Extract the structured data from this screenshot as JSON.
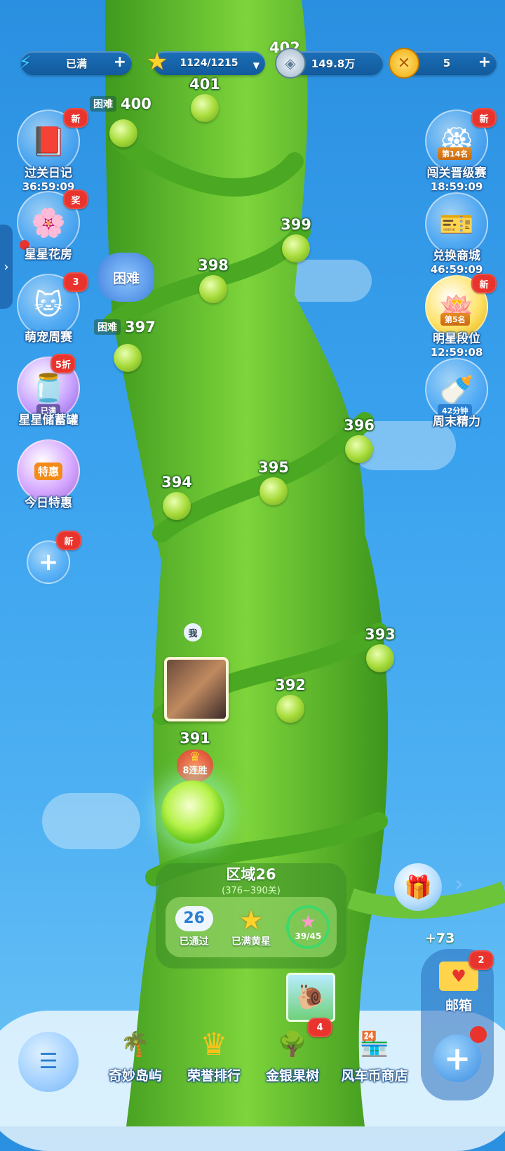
{
  "topbar": {
    "energy_label": "已满",
    "stars_label": "1124/1215",
    "coins_label": "149.8万",
    "gold_label": "5",
    "partial_level_label": "402"
  },
  "left_menu": [
    {
      "label": "过关日记",
      "timer": "36:59:09",
      "badge": "新"
    },
    {
      "label": "星星花房",
      "badge": "奖"
    },
    {
      "label": "萌宠周赛",
      "badge": "3"
    },
    {
      "label": "星星储蓄罐",
      "badge": "5折",
      "sub": "已满"
    },
    {
      "label": "今日特惠",
      "inner": "特惠"
    },
    {
      "badge": "新"
    }
  ],
  "right_menu": [
    {
      "label": "闯关晋级赛",
      "timer": "18:59:09",
      "badge": "新",
      "sub": "第14名"
    },
    {
      "label": "兑换商城",
      "timer": "46:59:09"
    },
    {
      "label": "明星段位",
      "timer": "12:59:08",
      "badge": "新",
      "sub": "第5名"
    },
    {
      "label": "周末精力",
      "sub": "42分钟"
    }
  ],
  "levels": {
    "l401": "401",
    "l400": "400",
    "l399": "399",
    "l398": "398",
    "l397": "397",
    "l396": "396",
    "l395": "395",
    "l394": "394",
    "l393": "393",
    "l392": "392",
    "l391": "391",
    "hard_tag": "困难",
    "hard_flower": "困难"
  },
  "player": {
    "me_label": "我",
    "streak": "8连胜"
  },
  "region": {
    "title": "区域26",
    "range": "(376~390关)",
    "passed_num": "26",
    "passed_label": "已通过",
    "stars_label": "已满黄星",
    "progress": "39/45"
  },
  "mail": {
    "plus_value": "+73",
    "badge": "2",
    "label": "邮箱"
  },
  "bottom_nav": [
    {
      "label": "奇妙岛屿"
    },
    {
      "label": "荣誉排行"
    },
    {
      "label": "金银果树",
      "badge": "4"
    },
    {
      "label": "风车币商店"
    }
  ],
  "colors": {
    "sky": "#3aa2ee",
    "stalk": "#5cbf2e",
    "badge_red": "#e8342d",
    "pill_blue": "#1b6fb8"
  }
}
